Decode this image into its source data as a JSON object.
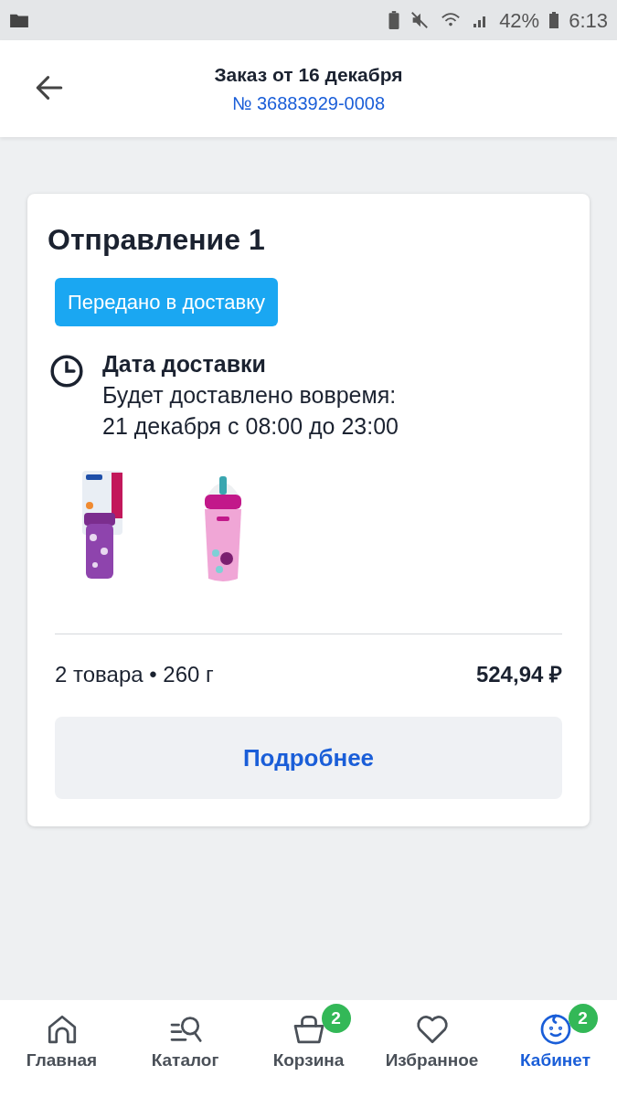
{
  "status_bar": {
    "battery": "42%",
    "time": "6:13"
  },
  "header": {
    "title": "Заказ от 16 декабря",
    "order_number": "№ 36883929-0008"
  },
  "shipment": {
    "title": "Отправление 1",
    "status": "Передано в доставку",
    "delivery_label": "Дата доставки",
    "delivery_note": "Будет доставлено вовремя:",
    "delivery_window": "21 декабря с 08:00 до 23:00",
    "summary": "2 товара • 260 г",
    "total": "524,94 ₽",
    "details_button": "Подробнее"
  },
  "nav": [
    {
      "label": "Главная",
      "kind": "home",
      "selected": false
    },
    {
      "label": "Каталог",
      "kind": "catalog",
      "selected": false
    },
    {
      "label": "Корзина",
      "kind": "basket",
      "badge": "2",
      "selected": false
    },
    {
      "label": "Избранное",
      "kind": "favorites",
      "selected": false
    },
    {
      "label": "Кабинет",
      "kind": "account",
      "badge": "2",
      "selected": true
    }
  ]
}
